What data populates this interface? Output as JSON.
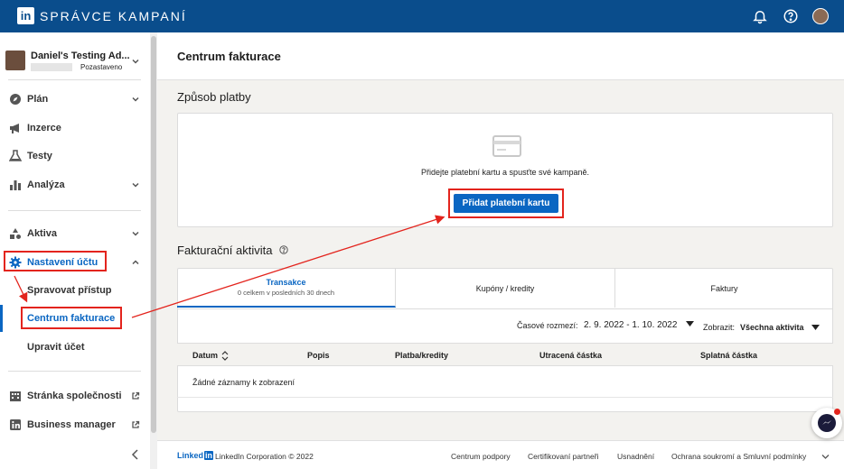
{
  "topbar": {
    "logo": "in",
    "title": "SPRÁVCE KAMPANÍ"
  },
  "account": {
    "name": "Daniel's Testing Ad...",
    "status": "Pozastaveno"
  },
  "sidebar": {
    "items": [
      {
        "label": "Plán"
      },
      {
        "label": "Inzerce"
      },
      {
        "label": "Testy"
      },
      {
        "label": "Analýza"
      },
      {
        "label": "Aktiva"
      },
      {
        "label": "Nastavení účtu"
      }
    ],
    "sub": [
      "Spravovat přístup",
      "Centrum fakturace",
      "Upravit účet"
    ],
    "links": [
      {
        "label": "Stránka společnosti"
      },
      {
        "label": "Business manager"
      }
    ]
  },
  "page": {
    "title": "Centrum fakturace"
  },
  "payment": {
    "title": "Způsob platby",
    "message": "Přidejte platební kartu a spusťte své kampaně.",
    "button": "Přidat platební kartu"
  },
  "activity": {
    "title": "Fakturační aktivita",
    "tabs": [
      {
        "label": "Transakce",
        "sub": "0 celkem v posledních 30 dnech"
      },
      {
        "label": "Kupóny / kredity"
      },
      {
        "label": "Faktury"
      }
    ],
    "range_label": "Časové rozmezí:",
    "range_value": "2. 9. 2022 - 1. 10. 2022",
    "show_label": "Zobrazit:",
    "show_value": "Všechna aktivita",
    "columns": [
      "Datum",
      "Popis",
      "Platba/kredity",
      "Utracená částka",
      "Splatná částka"
    ],
    "empty": "Žádné záznamy k zobrazení"
  },
  "footer": {
    "brand": "Linked",
    "brand_in": "in",
    "copyright": "LinkedIn Corporation © 2022",
    "links": [
      "Centrum podpory",
      "Certifikovaní partneři",
      "Usnadnění",
      "Ochrana soukromí a Smluvní podmínky"
    ]
  },
  "colors": {
    "brand": "#0a4d8c",
    "accent": "#0a66c2",
    "highlight": "#e3241d"
  }
}
